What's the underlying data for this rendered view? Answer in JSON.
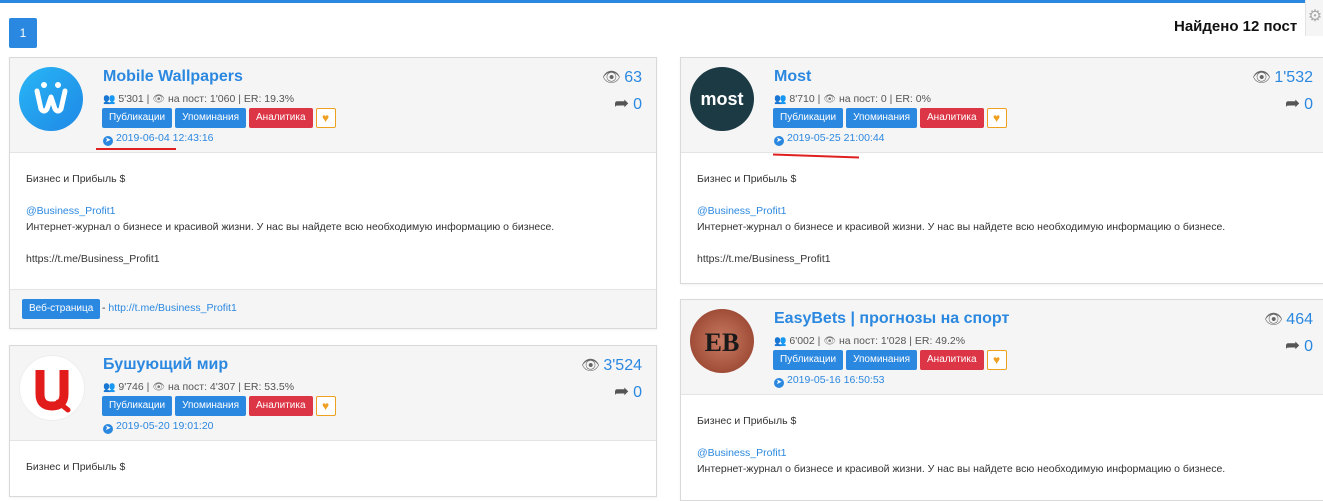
{
  "header": {
    "page_number": "1",
    "found_text": "Найдено 12 пост"
  },
  "colors": {
    "accent": "#2b88e0",
    "danger": "#dc3545",
    "favorite": "#f0a020"
  },
  "buttons": {
    "publications": "Публикации",
    "mentions": "Упоминания",
    "analytics": "Аналитика",
    "favorite_icon": "heart-icon"
  },
  "labels": {
    "per_post": "на пост:",
    "er": "ER:"
  },
  "post": {
    "title": "Бизнес и Прибыль $",
    "handle": "@Business_Profit1",
    "description": "Интернет-журнал о бизнесе и красивой жизни. У нас вы найдете всю необходимую информацию о бизнесе.",
    "link": "https://t.me/Business_Profit1"
  },
  "web": {
    "button": "Веб-страница",
    "link": "http://t.me/Business_Profit1"
  },
  "cards": {
    "c1": {
      "name": "Mobile Wallpapers",
      "subscribers": "5'301",
      "per_post": "1'060",
      "er": "19.3%",
      "date": "2019-06-04 12:43:16",
      "views": "63",
      "shares": "0"
    },
    "c2": {
      "name": "Most",
      "avatar_text": "most",
      "subscribers": "8'710",
      "per_post": "0",
      "er": "0%",
      "date": "2019-05-25 21:00:44",
      "views": "1'532",
      "shares": "0"
    },
    "c3": {
      "name": "Бушующий мир",
      "subscribers": "9'746",
      "per_post": "4'307",
      "er": "53.5%",
      "date": "2019-05-20 19:01:20",
      "views": "3'524",
      "shares": "0"
    },
    "c4": {
      "name": "EasyBets | прогнозы на спорт",
      "avatar_text": "EB",
      "subscribers": "6'002",
      "per_post": "1'028",
      "er": "49.2%",
      "date": "2019-05-16 16:50:53",
      "views": "464",
      "shares": "0"
    }
  }
}
